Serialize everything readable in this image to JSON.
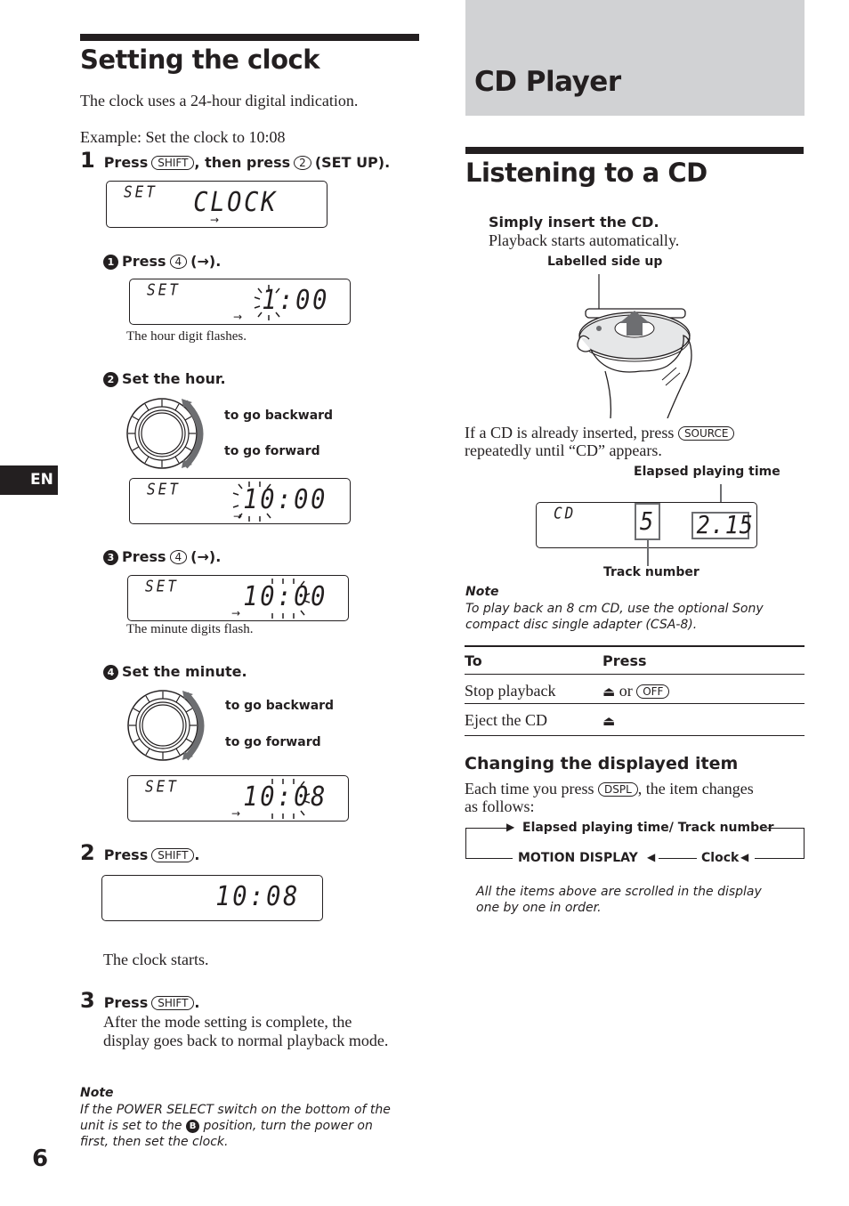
{
  "page_number": "6",
  "language_tab": "EN",
  "left": {
    "title": "Setting the clock",
    "intro": "The clock uses a 24-hour digital indication.",
    "example": "Example: Set the clock to 10:08",
    "step1": {
      "num": "1",
      "press": "Press",
      "key1": "SHIFT",
      "mid": ", then press",
      "key2": "2",
      "tail": "(SET UP).",
      "display": {
        "small": "SET",
        "big": "CLOCK"
      }
    },
    "sub1": {
      "num": "1",
      "press": "Press",
      "key": "4",
      "tail": "(→).",
      "display": {
        "small": "SET",
        "big": "1:00"
      },
      "caption": "The hour digit flashes."
    },
    "sub2": {
      "num": "2",
      "text": "Set the hour.",
      "backward": "to go backward",
      "forward": "to go forward",
      "display": {
        "small": "SET",
        "big": "10:00"
      }
    },
    "sub3": {
      "num": "3",
      "press": "Press",
      "key": "4",
      "tail": "(→).",
      "display": {
        "small": "SET",
        "big": "10:00"
      },
      "caption": "The minute digits flash."
    },
    "sub4": {
      "num": "4",
      "text": "Set the minute.",
      "backward": "to go backward",
      "forward": "to go forward",
      "display": {
        "small": "SET",
        "big": "10:08"
      }
    },
    "step2": {
      "num": "2",
      "press": "Press",
      "key": "SHIFT",
      "tail": ".",
      "display": {
        "big": "10:08"
      },
      "caption": "The clock starts."
    },
    "step3": {
      "num": "3",
      "press": "Press",
      "key": "SHIFT",
      "tail": ".",
      "body": "After the mode setting is complete, the display goes back to normal playback mode."
    },
    "note": {
      "title": "Note",
      "line1": "If the POWER SELECT switch on the bottom of the",
      "line2a": "unit is set to the",
      "line2_badge": "B",
      "line2b": "position, turn the power on",
      "line3": "first, then set the clock."
    }
  },
  "right": {
    "section_title": "CD Player",
    "title": "Listening to a CD",
    "insert_heading": "Simply insert the CD.",
    "insert_body": "Playback starts automatically.",
    "label_side_up": "Labelled side up",
    "already_text1": "If a CD is already inserted, press",
    "already_key": "SOURCE",
    "already_text2": "repeatedly until “CD” appears.",
    "elapsed_label": "Elapsed playing time",
    "track_label": "Track number",
    "display": {
      "small": "CD",
      "track": "5",
      "time": "2.15"
    },
    "note": {
      "title": "Note",
      "line1": "To play back an 8 cm CD, use the optional Sony",
      "line2": "compact disc single adapter (CSA-8)."
    },
    "table": {
      "headers": [
        "To",
        "Press"
      ],
      "rows": [
        {
          "to": "Stop playback",
          "icon": "⏏",
          "or": "or",
          "key": "OFF"
        },
        {
          "to": "Eject the CD",
          "icon": "⏏"
        }
      ]
    },
    "changing": {
      "title": "Changing the displayed item",
      "text1": "Each time you press",
      "key": "DSPL",
      "text2": ", the item changes",
      "text3": "as follows:",
      "cycle": [
        "Elapsed playing time/ Track number",
        "Clock",
        "MOTION DISPLAY"
      ],
      "note1": "All the items above are scrolled in the display",
      "note2": "one by one in order."
    }
  }
}
